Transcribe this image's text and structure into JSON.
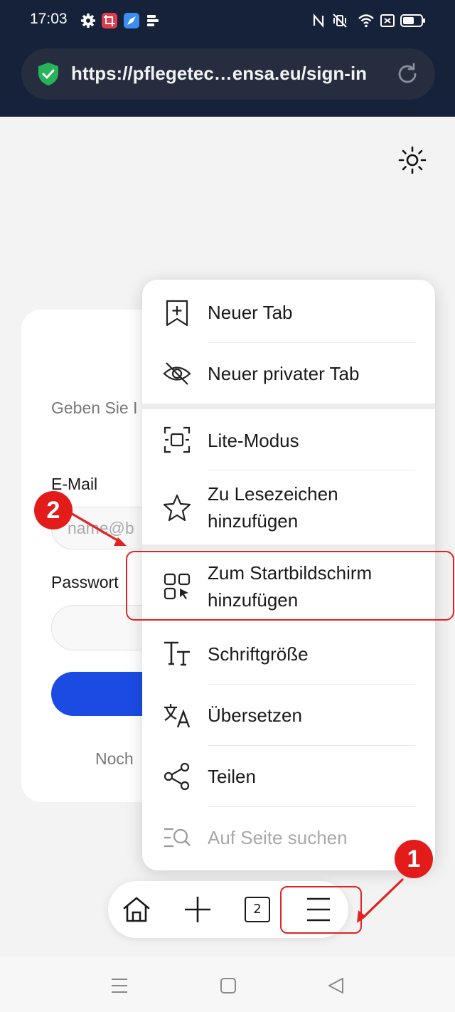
{
  "status_bar": {
    "time": "17:03",
    "icons": [
      "gear-icon",
      "crop-app-icon",
      "browser-app-icon",
      "stack-app-icon",
      "nfc-icon",
      "vibrate-mute-icon",
      "wifi-icon",
      "sim-off-icon",
      "battery-icon"
    ]
  },
  "browser": {
    "url": "https://pflegetec…ensa.eu/sign-in",
    "secure_icon": "shield-check-icon",
    "reload_icon": "reload-icon"
  },
  "page": {
    "theme_icon": "sun-icon",
    "description_partial": "Geben Sie I",
    "email_label": "E-Mail",
    "email_placeholder": "name@b",
    "password_label": "Passwort",
    "footer_partial": "Noch",
    "primary_color": "#1c4be4"
  },
  "menu": {
    "items": [
      {
        "label": "Neuer Tab",
        "icon": "bookmark-plus-icon",
        "enabled": true
      },
      {
        "label": "Neuer privater Tab",
        "icon": "eye-off-icon",
        "enabled": true
      },
      {
        "label": "Lite-Modus",
        "icon": "lite-mode-icon",
        "enabled": true
      },
      {
        "label": "Zu Lesezeichen\nhinzufügen",
        "icon": "star-icon",
        "enabled": true
      },
      {
        "label": "Zum Startbildschirm\nhinzufügen",
        "icon": "add-to-homescreen-icon",
        "enabled": true,
        "highlighted": true
      },
      {
        "label": "Schriftgröße",
        "icon": "text-size-icon",
        "enabled": true
      },
      {
        "label": "Übersetzen",
        "icon": "translate-icon",
        "enabled": true
      },
      {
        "label": "Teilen",
        "icon": "share-icon",
        "enabled": true
      },
      {
        "label": "Auf Seite suchen",
        "icon": "find-in-page-icon",
        "enabled": false
      }
    ]
  },
  "toolbar": {
    "home_icon": "home-icon",
    "new_tab_icon": "plus-icon",
    "tab_count": "2",
    "menu_icon": "hamburger-menu-icon"
  },
  "annotations": {
    "step1": "1",
    "step2": "2",
    "color": "#e02323"
  },
  "system_nav": [
    "recents-icon",
    "home-square-icon",
    "back-icon"
  ]
}
